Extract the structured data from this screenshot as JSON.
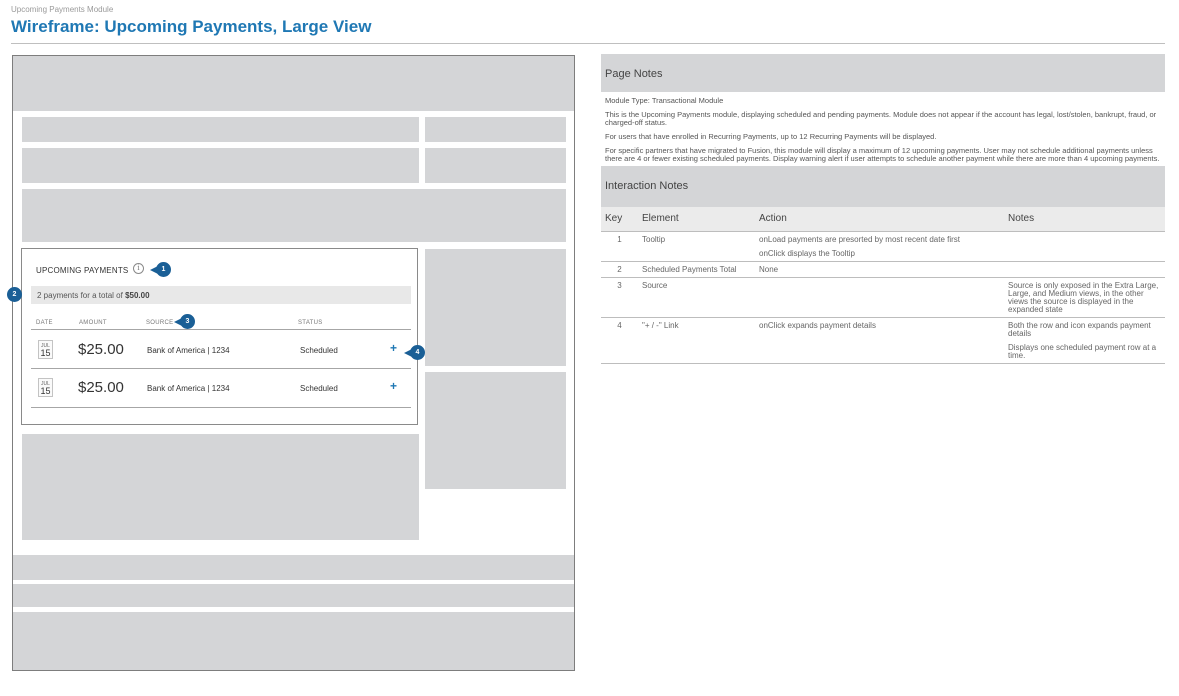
{
  "doc": {
    "subtitle": "Upcoming Payments Module",
    "title": "Wireframe: Upcoming Payments, Large View"
  },
  "module": {
    "title": "UPCOMING PAYMENTS",
    "tooltip_icon": "info-icon",
    "total_prefix": "2 payments for a total of",
    "total_amount": "$50.00",
    "columns": {
      "date": "DATE",
      "amount": "AMOUNT",
      "source": "SOURCE",
      "status": "STATUS"
    },
    "payments": [
      {
        "month": "JUL",
        "day": "15",
        "amount": "$25.00",
        "source": "Bank of America | 1234",
        "status": "Scheduled",
        "expand": "+"
      },
      {
        "month": "JUL",
        "day": "15",
        "amount": "$25.00",
        "source": "Bank of America | 1234",
        "status": "Scheduled",
        "expand": "+"
      }
    ]
  },
  "markers": [
    "1",
    "2",
    "3",
    "4"
  ],
  "page_notes": {
    "heading": "Page Notes",
    "paragraphs": [
      "Module Type: Transactional Module",
      "This is the Upcoming Payments module, displaying scheduled and pending payments. Module does not appear if the account has legal, lost/stolen, bankrupt, fraud, or charged-off status.",
      "For users that have enrolled in Recurring Payments, up to 12 Recurring Payments will be displayed.",
      "For specific partners that have migrated to Fusion, this module will display a maximum of 12 upcoming payments. User may not schedule additional payments unless there are 4 or fewer existing scheduled payments. Display warning alert if user attempts to schedule another payment while there are more than 4 upcoming payments."
    ]
  },
  "interaction_notes": {
    "heading": "Interaction Notes",
    "columns": {
      "key": "Key",
      "element": "Element",
      "action": "Action",
      "notes": "Notes"
    },
    "rows": [
      {
        "key": "1",
        "element": "Tooltip",
        "action": "onLoad payments are presorted by most recent date first",
        "action2": "onClick displays the Tooltip",
        "notes": "",
        "notes2": ""
      },
      {
        "key": "2",
        "element": "Scheduled Payments Total",
        "action": "None",
        "action2": "",
        "notes": "",
        "notes2": ""
      },
      {
        "key": "3",
        "element": "Source",
        "action": "",
        "action2": "",
        "notes": "Source is only exposed in the Extra Large, Large, and Medium views, in the other views the source is displayed in the expanded state",
        "notes2": ""
      },
      {
        "key": "4",
        "element": "\"+ / -\" Link",
        "action": "onClick expands payment details",
        "action2": "",
        "notes": "Both the row and icon expands payment details",
        "notes2": "Displays one scheduled payment row at a time."
      }
    ]
  },
  "colors": {
    "accent": "#1f78b4",
    "marker": "#1a5f96",
    "placeholder": "#d4d5d7"
  }
}
